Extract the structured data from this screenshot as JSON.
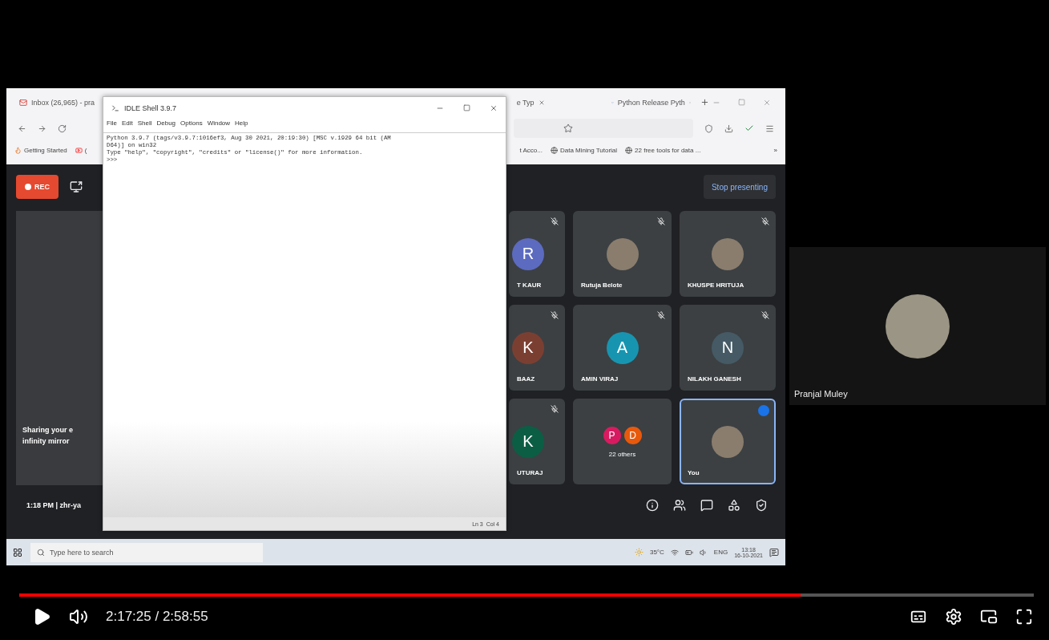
{
  "video_frame": {
    "browser": {
      "tabs": [
        {
          "label": "Inbox (26,965) - pra",
          "kind": "mail"
        },
        {
          "label": "e Typ",
          "kind": "plain"
        },
        {
          "label": "Python Release Pyth",
          "kind": "python"
        }
      ],
      "bookmarks_left": [
        {
          "label": "Getting Started",
          "kind": "fire"
        },
        {
          "label": "(",
          "kind": "video"
        }
      ],
      "bookmarks_right": [
        {
          "label": "t Acco...",
          "kind": "plain"
        },
        {
          "label": "Data Mining Tutorial",
          "kind": "globe"
        },
        {
          "label": "22 free tools for data ...",
          "kind": "globe"
        }
      ],
      "overflow": "»"
    },
    "idle": {
      "title": "IDLE Shell 3.9.7",
      "menu": [
        "File",
        "Edit",
        "Shell",
        "Debug",
        "Options",
        "Window",
        "Help"
      ],
      "lines": [
        "Python 3.9.7 (tags/v3.9.7:1016ef3, Aug 30 2021, 20:19:30) [MSC v.1929 64 bit (AM",
        "D64)] on win32",
        "Type \"help\", \"copyright\", \"credits\" or \"license()\" for more information.",
        ">>> "
      ],
      "status": "Ln 3  Col 4"
    },
    "meet": {
      "rec": "REC",
      "stop_presenting": "Stop presenting",
      "preview_lines": [
        "Sharing your e",
        "infinity mirror"
      ],
      "clock": "1:18 PM",
      "separator": "|",
      "meeting_code": "zhr-ya",
      "tiles": [
        {
          "name": "T KAUR",
          "kind": "letter",
          "letter": "R",
          "color": "#5c6bc0",
          "muted": true,
          "active_speaker": false
        },
        {
          "name": "Rutuja Belote",
          "kind": "photo",
          "muted": true,
          "active_speaker": false
        },
        {
          "name": "KHUSPE HRITUJA",
          "kind": "photo",
          "muted": true,
          "active_speaker": false
        },
        {
          "name": "BAAZ",
          "kind": "letter",
          "letter": "K",
          "color": "#7b3f32",
          "muted": true,
          "active_speaker": false
        },
        {
          "name": "AMIN VIRAJ",
          "kind": "letter",
          "letter": "A",
          "color": "#1795b0",
          "muted": true,
          "active_speaker": false
        },
        {
          "name": "NILAKH GANESH",
          "kind": "letter",
          "letter": "N",
          "color": "#455a64",
          "muted": true,
          "active_speaker": false
        },
        {
          "name": "UTURAJ",
          "kind": "letter",
          "letter": "K",
          "color": "#0b5e44",
          "muted": true,
          "active_speaker": false
        },
        {
          "name": "22 others",
          "kind": "group",
          "avatars": [
            {
              "letter": "P",
              "color": "#d81b60"
            },
            {
              "letter": "D",
              "color": "#e8590c"
            }
          ],
          "muted": false,
          "active_speaker": false
        },
        {
          "name": "You",
          "kind": "photo",
          "muted": false,
          "active_speaker": true
        }
      ]
    },
    "taskbar": {
      "search_placeholder": "Type here to search",
      "weather": "35°C",
      "language": "ENG",
      "time": "13:18",
      "date": "16-10-2021"
    }
  },
  "side_tile": {
    "name": "Pranjal Muley"
  },
  "player": {
    "progress": {
      "level": 0.77
    },
    "time": "2:17:25 / 2:58:55"
  }
}
